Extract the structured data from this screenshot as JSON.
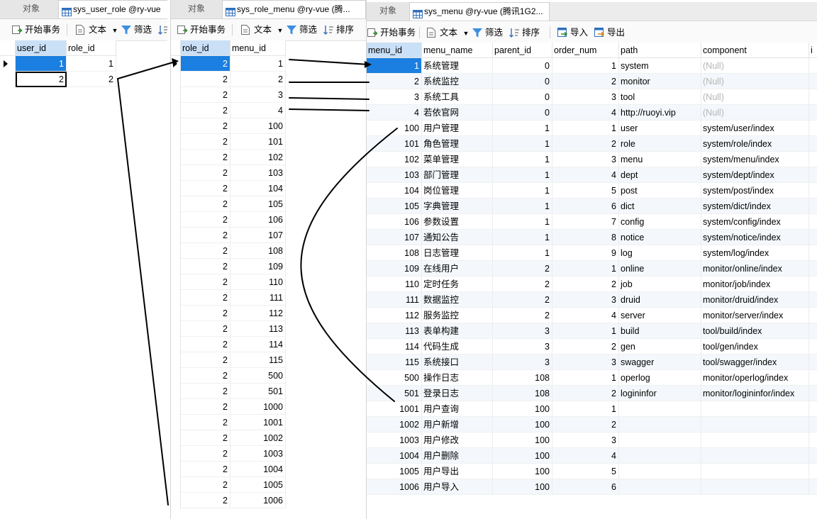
{
  "tabs": {
    "objects_label": "对象"
  },
  "toolbar": {
    "begin_transaction": "开始事务",
    "text": "文本",
    "filter": "筛选",
    "sort": "排序",
    "import": "导入",
    "export": "导出"
  },
  "panel1": {
    "tab_title": "sys_user_role @ry-vue",
    "columns": [
      "user_id",
      "role_id"
    ],
    "rows": [
      [
        "1",
        "1"
      ],
      [
        "2",
        "2"
      ]
    ]
  },
  "panel2": {
    "tab_title": "sys_role_menu @ry-vue (腾...",
    "columns": [
      "role_id",
      "menu_id"
    ],
    "rows": [
      [
        "2",
        "1"
      ],
      [
        "2",
        "2"
      ],
      [
        "2",
        "3"
      ],
      [
        "2",
        "4"
      ],
      [
        "2",
        "100"
      ],
      [
        "2",
        "101"
      ],
      [
        "2",
        "102"
      ],
      [
        "2",
        "103"
      ],
      [
        "2",
        "104"
      ],
      [
        "2",
        "105"
      ],
      [
        "2",
        "106"
      ],
      [
        "2",
        "107"
      ],
      [
        "2",
        "108"
      ],
      [
        "2",
        "109"
      ],
      [
        "2",
        "110"
      ],
      [
        "2",
        "111"
      ],
      [
        "2",
        "112"
      ],
      [
        "2",
        "113"
      ],
      [
        "2",
        "114"
      ],
      [
        "2",
        "115"
      ],
      [
        "2",
        "500"
      ],
      [
        "2",
        "501"
      ],
      [
        "2",
        "1000"
      ],
      [
        "2",
        "1001"
      ],
      [
        "2",
        "1002"
      ],
      [
        "2",
        "1003"
      ],
      [
        "2",
        "1004"
      ],
      [
        "2",
        "1005"
      ],
      [
        "2",
        "1006"
      ]
    ]
  },
  "panel3": {
    "tab_title": "sys_menu @ry-vue (腾讯1G2...",
    "columns": [
      "menu_id",
      "menu_name",
      "parent_id",
      "order_num",
      "path",
      "component",
      "i"
    ],
    "rows": [
      [
        "1",
        "系统管理",
        "0",
        "1",
        "system",
        "(Null)"
      ],
      [
        "2",
        "系统监控",
        "0",
        "2",
        "monitor",
        "(Null)"
      ],
      [
        "3",
        "系统工具",
        "0",
        "3",
        "tool",
        "(Null)"
      ],
      [
        "4",
        "若依官网",
        "0",
        "4",
        "http://ruoyi.vip",
        "(Null)"
      ],
      [
        "100",
        "用户管理",
        "1",
        "1",
        "user",
        "system/user/index"
      ],
      [
        "101",
        "角色管理",
        "1",
        "2",
        "role",
        "system/role/index"
      ],
      [
        "102",
        "菜单管理",
        "1",
        "3",
        "menu",
        "system/menu/index"
      ],
      [
        "103",
        "部门管理",
        "1",
        "4",
        "dept",
        "system/dept/index"
      ],
      [
        "104",
        "岗位管理",
        "1",
        "5",
        "post",
        "system/post/index"
      ],
      [
        "105",
        "字典管理",
        "1",
        "6",
        "dict",
        "system/dict/index"
      ],
      [
        "106",
        "参数设置",
        "1",
        "7",
        "config",
        "system/config/index"
      ],
      [
        "107",
        "通知公告",
        "1",
        "8",
        "notice",
        "system/notice/index"
      ],
      [
        "108",
        "日志管理",
        "1",
        "9",
        "log",
        "system/log/index"
      ],
      [
        "109",
        "在线用户",
        "2",
        "1",
        "online",
        "monitor/online/index"
      ],
      [
        "110",
        "定时任务",
        "2",
        "2",
        "job",
        "monitor/job/index"
      ],
      [
        "111",
        "数据监控",
        "2",
        "3",
        "druid",
        "monitor/druid/index"
      ],
      [
        "112",
        "服务监控",
        "2",
        "4",
        "server",
        "monitor/server/index"
      ],
      [
        "113",
        "表单构建",
        "3",
        "1",
        "build",
        "tool/build/index"
      ],
      [
        "114",
        "代码生成",
        "3",
        "2",
        "gen",
        "tool/gen/index"
      ],
      [
        "115",
        "系统接口",
        "3",
        "3",
        "swagger",
        "tool/swagger/index"
      ],
      [
        "500",
        "操作日志",
        "108",
        "1",
        "operlog",
        "monitor/operlog/index"
      ],
      [
        "501",
        "登录日志",
        "108",
        "2",
        "logininfor",
        "monitor/logininfor/index"
      ],
      [
        "1001",
        "用户查询",
        "100",
        "1",
        "",
        ""
      ],
      [
        "1002",
        "用户新增",
        "100",
        "2",
        "",
        ""
      ],
      [
        "1003",
        "用户修改",
        "100",
        "3",
        "",
        ""
      ],
      [
        "1004",
        "用户删除",
        "100",
        "4",
        "",
        ""
      ],
      [
        "1005",
        "用户导出",
        "100",
        "5",
        "",
        ""
      ],
      [
        "1006",
        "用户导入",
        "100",
        "6",
        "",
        ""
      ]
    ]
  }
}
